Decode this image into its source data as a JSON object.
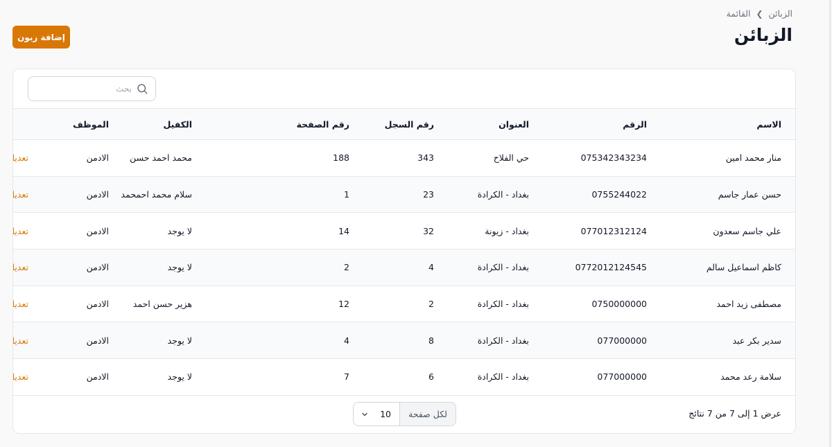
{
  "breadcrumb": {
    "items": [
      "الزبائن",
      "القائمة"
    ]
  },
  "page": {
    "title": "الزبائن",
    "add_button": "إضافة زبون"
  },
  "search": {
    "placeholder": "بحث"
  },
  "table": {
    "headers": {
      "name": "الاسم",
      "number": "الرقم",
      "address": "العنوان",
      "record": "رقم السجل",
      "page_no": "رقم الصفحة",
      "guarantor": "الكفيل",
      "employee": "الموظف"
    },
    "edit_label": "تعديل",
    "rows": [
      {
        "name": "منار محمد امين",
        "number": "075342343234",
        "address": "حي الفلاح",
        "record": "343",
        "page_no": "188",
        "guarantor": "محمد احمد حسن",
        "employee": "الادمن"
      },
      {
        "name": "حسن عمار جاسم",
        "number": "0755244022",
        "address": "بغداد - الكرادة",
        "record": "23",
        "page_no": "1",
        "guarantor": "سلام محمد احمحمد",
        "employee": "الادمن"
      },
      {
        "name": "علي جاسم سعدون",
        "number": "077012312124",
        "address": "بغداد - زيونة",
        "record": "32",
        "page_no": "14",
        "guarantor": "لا يوجد",
        "employee": "الادمن"
      },
      {
        "name": "كاظم اسماعيل سالم",
        "number": "0772012124545",
        "address": "بغداد - الكرادة",
        "record": "4",
        "page_no": "2",
        "guarantor": "لا يوجد",
        "employee": "الادمن"
      },
      {
        "name": "مصطفى زيد احمد",
        "number": "0750000000",
        "address": "بغداد - الكرادة",
        "record": "2",
        "page_no": "12",
        "guarantor": "هزير حسن احمد",
        "employee": "الادمن"
      },
      {
        "name": "سدير بكر عبد",
        "number": "077000000",
        "address": "بغداد - الكرادة",
        "record": "8",
        "page_no": "4",
        "guarantor": "لا يوجد",
        "employee": "الادمن"
      },
      {
        "name": "سلامة رعد محمد",
        "number": "077000000",
        "address": "بغداد - الكرادة",
        "record": "6",
        "page_no": "7",
        "guarantor": "لا يوجد",
        "employee": "الادمن"
      }
    ]
  },
  "footer": {
    "results_text": "عرض 1 إلى 7 من 7 نتائج",
    "per_page_label": "لكل صفحة",
    "per_page_value": "10"
  },
  "colors": {
    "accent": "#d97706",
    "border": "#e5e7eb",
    "row_alt": "#f9fafb"
  },
  "icons": {
    "search": "search-icon",
    "edit": "edit-icon",
    "chevron": "chevron-down-icon",
    "separator": "chevron-left-icon"
  }
}
